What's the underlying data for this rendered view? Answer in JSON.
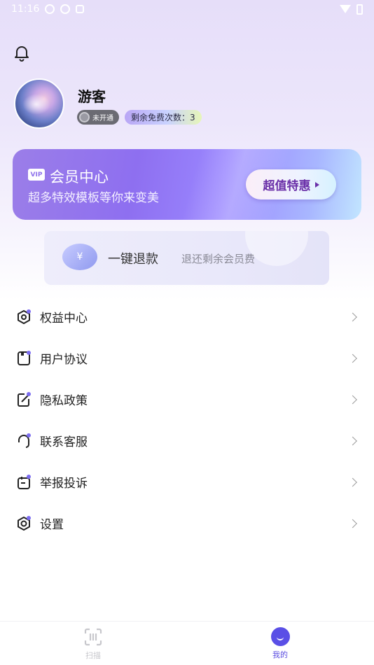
{
  "status_bar": {
    "time": "11:16"
  },
  "profile": {
    "name": "游客",
    "membership_status": "未开通",
    "free_uses_label": "剩余免费次数：",
    "free_uses_count": "3"
  },
  "vip_card": {
    "tag": "VIP",
    "title": "会员中心",
    "subtitle": "超多特效模板等你来变美",
    "button_label": "超值特惠"
  },
  "refund_card": {
    "icon_glyph": "¥",
    "title": "一键退款",
    "subtitle": "退还剩余会员费"
  },
  "menu": {
    "items": [
      {
        "label": "权益中心",
        "icon": "hexagon-badge-icon"
      },
      {
        "label": "用户协议",
        "icon": "document-icon"
      },
      {
        "label": "隐私政策",
        "icon": "edit-doc-icon"
      },
      {
        "label": "联系客服",
        "icon": "headset-icon"
      },
      {
        "label": "举报投诉",
        "icon": "clipboard-icon"
      },
      {
        "label": "设置",
        "icon": "gear-icon"
      }
    ]
  },
  "tabbar": {
    "tabs": [
      {
        "label": "扫描",
        "active": false
      },
      {
        "label": "我的",
        "active": true
      }
    ]
  },
  "colors": {
    "accent": "#5a4fe6",
    "vip_gradient_start": "#9b7ee8",
    "vip_button_text": "#6a2fa8"
  }
}
